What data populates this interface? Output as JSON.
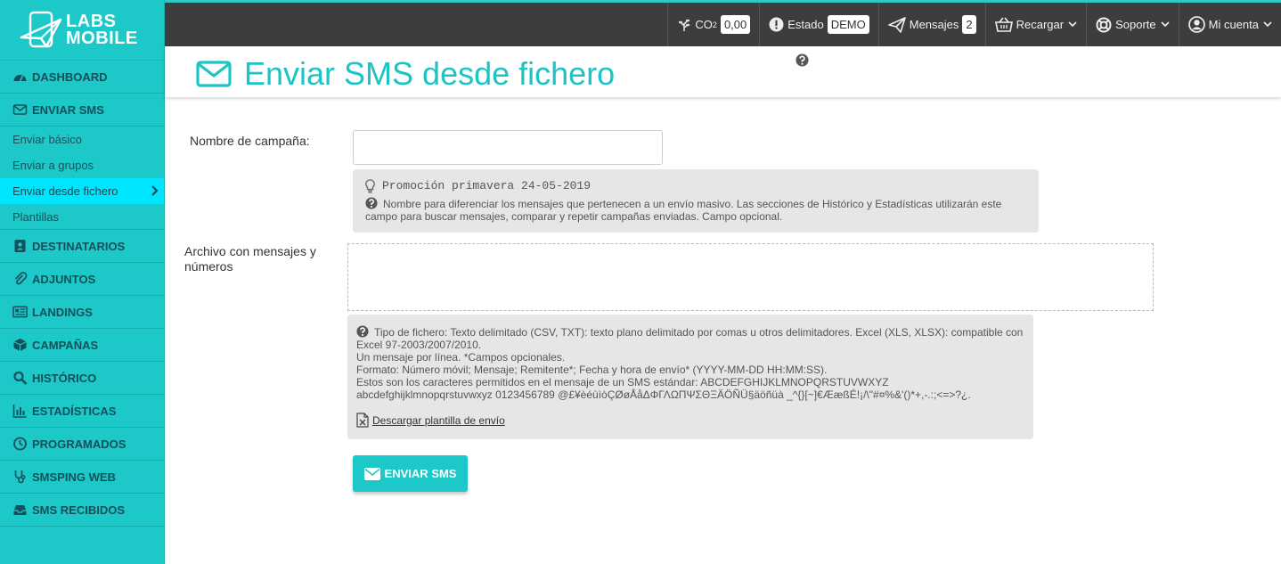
{
  "app": {
    "logo_line1": "LABS",
    "logo_line2": "MOBILE"
  },
  "sidebar": {
    "items": [
      {
        "label": "DASHBOARD",
        "icon": "dashboard-icon"
      },
      {
        "label": "ENVIAR SMS",
        "icon": "envelope-icon"
      },
      {
        "label": "DESTINATARIOS",
        "icon": "contacts-icon"
      },
      {
        "label": "ADJUNTOS",
        "icon": "paperclip-icon"
      },
      {
        "label": "LANDINGS",
        "icon": "newspaper-icon"
      },
      {
        "label": "CAMPAÑAS",
        "icon": "cube-icon"
      },
      {
        "label": "HISTÓRICO",
        "icon": "search-icon"
      },
      {
        "label": "ESTADÍSTICAS",
        "icon": "bar-chart-icon"
      },
      {
        "label": "PROGRAMADOS",
        "icon": "clock-icon"
      },
      {
        "label": "SMSPING WEB",
        "icon": "stethoscope-icon"
      },
      {
        "label": "SMS RECIBIDOS",
        "icon": "inbox-icon"
      }
    ],
    "sub_items": [
      {
        "label": "Enviar básico"
      },
      {
        "label": "Enviar a grupos"
      },
      {
        "label": "Enviar desde fichero"
      },
      {
        "label": "Plantillas"
      }
    ]
  },
  "topbar": {
    "co2_label": "CO",
    "co2_sub": "2",
    "co2_value": "0,00",
    "estado_label": "Estado",
    "estado_value": "DEMO",
    "mensajes_label": "Mensajes",
    "mensajes_count": "2",
    "recargar_label": "Recargar",
    "soporte_label": "Soporte",
    "cuenta_label": "Mi cuenta"
  },
  "page": {
    "title": "Enviar SMS desde fichero"
  },
  "form": {
    "campaign_label": "Nombre de campaña:",
    "campaign_value": "",
    "campaign_example": "Promoción primavera 24-05-2019",
    "campaign_help": "Nombre para diferenciar los mensajes que pertenecen a un envío masivo. Las secciones de Histórico y Estadísticas utilizarán este campo para buscar mensajes, comparar y repetir campañas enviadas. Campo opcional.",
    "file_label": "Archivo con mensajes y números",
    "file_help_line1": "Tipo de fichero: Texto delimitado (CSV, TXT): texto plano delimitado por comas u otros delimitadores. Excel (XLS, XLSX): compatible con Excel 97-2003/2007/2010.",
    "file_help_line2": "Un mensaje por línea. *Campos opcionales.",
    "file_help_line3": "Formato: Número móvil; Mensaje; Remitente*; Fecha y hora de envío* (YYYY-MM-DD HH:MM:SS).",
    "file_help_line4": "Estos son los caracteres permitidos en el mensaje de un SMS estándar: ABCDEFGHIJKLMNOPQRSTUVWXYZ",
    "file_help_line5": "abcdefghijklmnopqrstuvwxyz 0123456789 @£¥èéùìòÇØøÅåΔΦΓΛΩΠΨΣΘΞÄÖÑÜ§äöñüà _^{}[~]€ÆæßÉ!¡/\\\"#¤%&'()*+,-.:;<=>?¿.",
    "download_label": "Descargar plantilla de envío",
    "submit_label": "ENVIAR SMS"
  }
}
